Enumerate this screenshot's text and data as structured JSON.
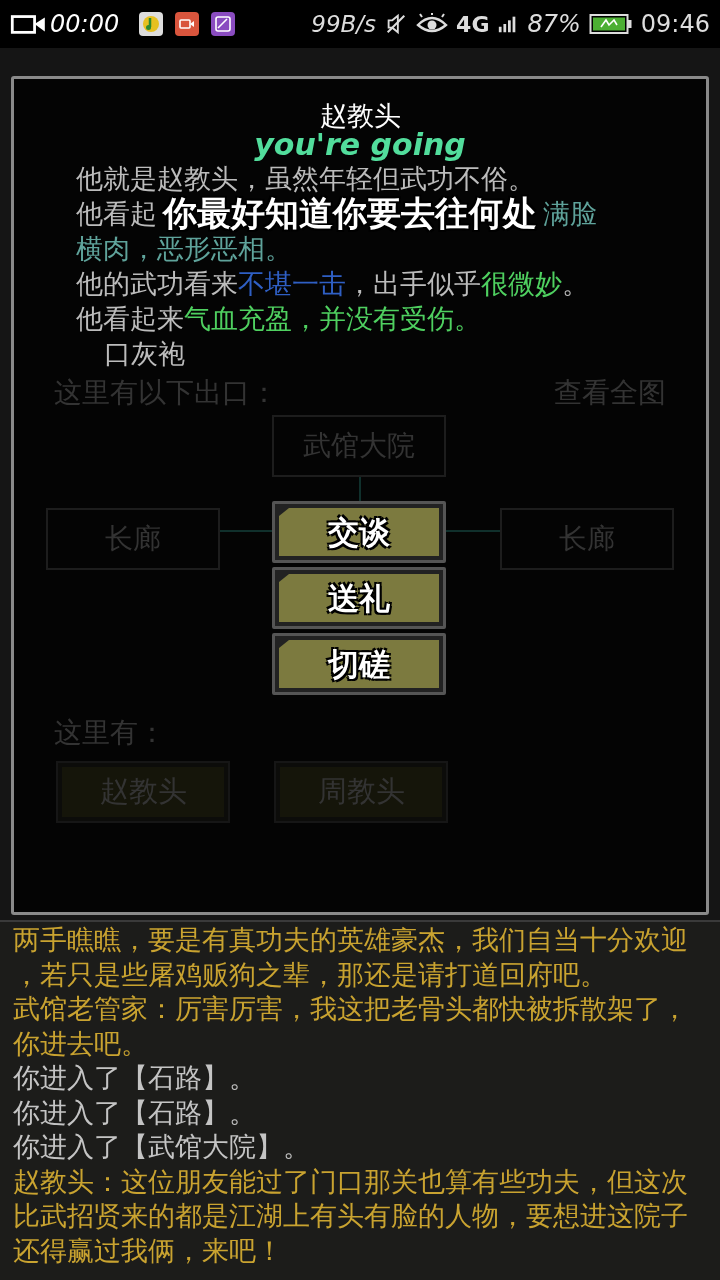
{
  "status_bar": {
    "recording_time": "00:00",
    "net_speed": "99B/s",
    "network": "4G",
    "battery": "87%",
    "time": "09:46"
  },
  "dialog": {
    "title": "赵教头",
    "subtitle": "you're going",
    "lines": [
      {
        "segments": [
          {
            "kind": "normal",
            "text": "他就是赵教头，虽然年轻但武功不俗。"
          }
        ]
      },
      {
        "segments": [
          {
            "kind": "normal",
            "text": "他看起"
          },
          {
            "kind": "caption",
            "text": "你最好知道你要去往何处"
          },
          {
            "kind": "teal",
            "text": "满脸"
          }
        ]
      },
      {
        "segments": [
          {
            "kind": "teal",
            "text": "横肉，恶形恶相。"
          }
        ]
      },
      {
        "segments": [
          {
            "kind": "normal",
            "text": "他的武功看来"
          },
          {
            "kind": "blue",
            "text": "不堪一击"
          },
          {
            "kind": "normal",
            "text": "，出手似乎"
          },
          {
            "kind": "green",
            "text": "很微妙"
          },
          {
            "kind": "normal",
            "text": "。"
          }
        ]
      },
      {
        "segments": [
          {
            "kind": "normal",
            "text": "他看起来"
          },
          {
            "kind": "green",
            "text": "气血充盈，并没有受伤。"
          }
        ]
      }
    ],
    "item": "口灰袍",
    "actions": [
      "交谈",
      "送礼",
      "切磋"
    ]
  },
  "room": {
    "exits_label": "这里有以下出口：",
    "map_link": "查看全图",
    "exits": {
      "north": "武馆大院",
      "west": "长廊",
      "east": "长廊"
    },
    "people_label": "这里有：",
    "people": [
      "赵教头",
      "周教头"
    ]
  },
  "log": [
    {
      "kind": "yellow",
      "text": "两手瞧瞧，要是有真功夫的英雄豪杰，我们自当十分欢迎，若只是些屠鸡贩狗之辈，那还是请打道回府吧。"
    },
    {
      "kind": "yellow",
      "text": "武馆老管家：厉害厉害，我这把老骨头都快被拆散架了，你进去吧。"
    },
    {
      "kind": "grey",
      "text": "你进入了【石路】。"
    },
    {
      "kind": "grey",
      "text": "你进入了【石路】。"
    },
    {
      "kind": "grey",
      "text": "你进入了【武馆大院】。"
    },
    {
      "kind": "yellow",
      "text": "赵教头：这位朋友能过了门口那关也算有些功夫，但这次比武招贤来的都是江湖上有头有脸的人物，要想进这院子还得赢过我俩，来吧！"
    }
  ]
}
